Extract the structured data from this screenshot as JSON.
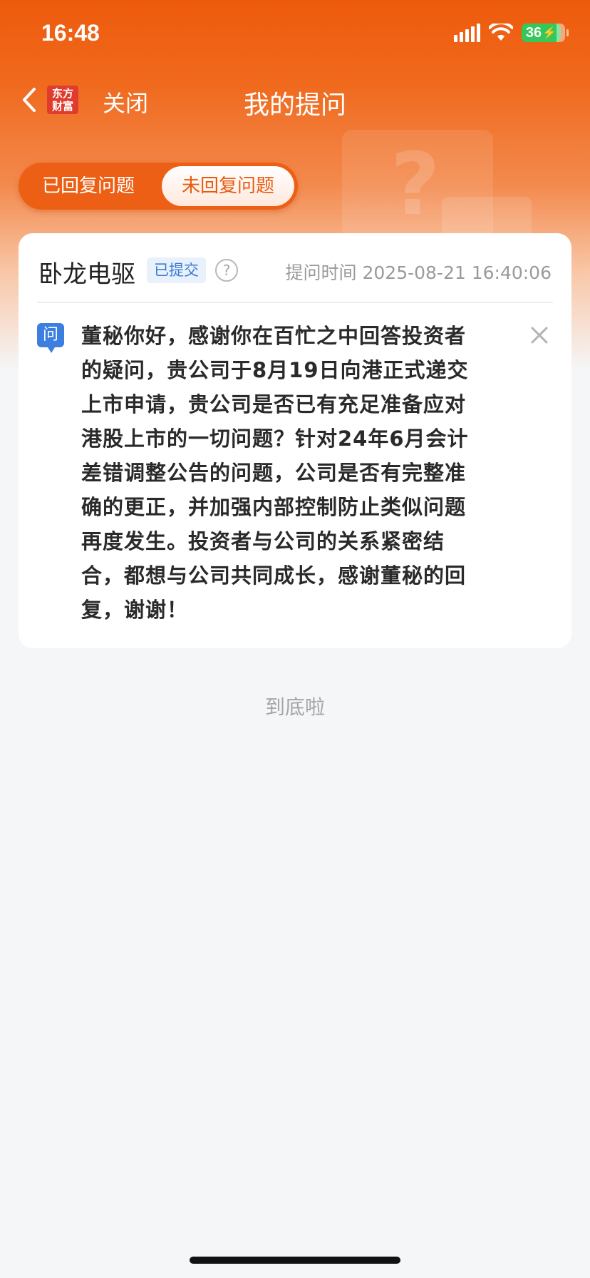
{
  "status_bar": {
    "time": "16:48",
    "battery": "36"
  },
  "nav": {
    "logo_line1": "东方",
    "logo_line2": "财富",
    "close_label": "关闭",
    "title": "我的提问"
  },
  "tabs": [
    {
      "label": "已回复问题",
      "active": false
    },
    {
      "label": "未回复问题",
      "active": true
    }
  ],
  "card": {
    "company": "卧龙电驱",
    "status": "已提交",
    "ask_time": "提问时间 2025-08-21 16:40:06",
    "question_icon_label": "问",
    "question": "董秘你好，感谢你在百忙之中回答投资者的疑问，贵公司于8月19日向港正式递交上市申请，贵公司是否已有充足准备应对港股上市的一切问题？针对24年6月会计差错调整公告的问题，公司是否有完整准确的更正，并加强内部控制防止类似问题再度发生。投资者与公司的关系紧密结合，都想与公司共同成长，感谢董秘的回复，谢谢！"
  },
  "footer": {
    "end_text": "到底啦"
  },
  "colors": {
    "brand_orange": "#ee5a0c",
    "badge_blue": "#3a7bd5",
    "battery_green": "#34c759"
  },
  "icons": {
    "back": "chevron-left-icon",
    "help": "question-circle-icon",
    "close": "close-icon",
    "question": "question-badge-icon"
  }
}
